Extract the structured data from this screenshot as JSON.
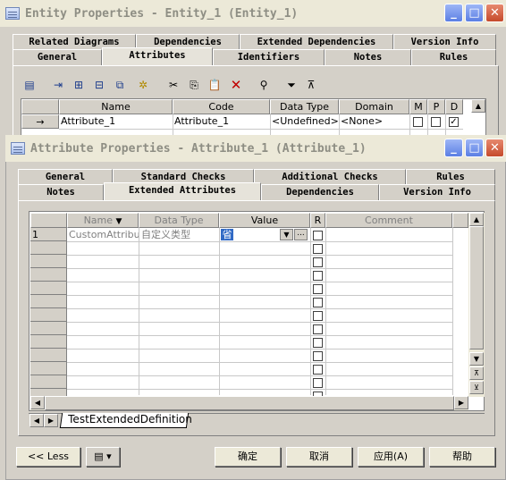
{
  "outer_window": {
    "title": "Entity Properties - Entity_1 (Entity_1)",
    "tabs_row1": [
      "Related Diagrams",
      "Dependencies",
      "Extended Dependencies",
      "Version Info"
    ],
    "tabs_row2": [
      "General",
      "Attributes",
      "Identifiers",
      "Notes",
      "Rules"
    ],
    "active_tab": "Attributes",
    "grid": {
      "columns": [
        "Name",
        "Code",
        "Data Type",
        "Domain",
        "M",
        "P",
        "D"
      ],
      "rows": [
        {
          "marker": "→",
          "name": "Attribute_1",
          "code": "Attribute_1",
          "data_type": "<Undefined>",
          "domain": "<None>",
          "m": false,
          "p": false,
          "d": true
        }
      ]
    }
  },
  "inner_window": {
    "title": "Attribute Properties - Attribute_1 (Attribute_1)",
    "tabs_row1": [
      "General",
      "Standard Checks",
      "Additional Checks",
      "Rules"
    ],
    "tabs_row2": [
      "Notes",
      "Extended Attributes",
      "Dependencies",
      "Version Info"
    ],
    "active_tab": "Extended Attributes",
    "grid": {
      "columns": [
        "Name",
        "Data Type",
        "Value",
        "R",
        "Comment"
      ],
      "rows": [
        {
          "num": "1",
          "name": "CustomAttribute",
          "data_type": "自定义类型",
          "value": "省",
          "r": false,
          "comment": ""
        }
      ],
      "empty_rows": 12
    },
    "sheet_tab": "TestExtendedDefinition",
    "buttons": {
      "less": "<< Less",
      "ok": "确定",
      "cancel": "取消",
      "apply": "应用(A)",
      "help": "帮助"
    }
  },
  "colors": {
    "title_text": "#8e8e84",
    "title_bg": "#ece9d8",
    "window_bg": "#d4d0c8",
    "selected_value_bg": "#316ac5"
  }
}
